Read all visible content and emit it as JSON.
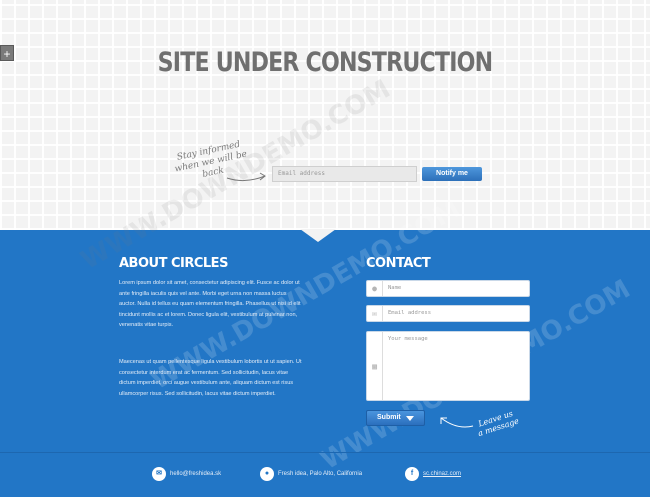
{
  "hero": {
    "title": "SITE UNDER CONSTRUCTION",
    "tagline_line1": "Stay informed",
    "tagline_line2": "when we will be back",
    "email_placeholder": "Email address",
    "notify_label": "Notify me"
  },
  "about": {
    "heading": "ABOUT CIRCLES",
    "paragraph1": "Lorem ipsum dolor sit amet, consectetur adipiscing elit. Fusce ac dolor ut ante fringilla iaculis quis vel ante. Morbi eget urna non massa luctus auctor. Nulla id tellus eu quam elementum fringilla. Phasellus ut nisi id elit tincidunt mollis ac et lorem. Donec ligula elit, vestibulum at pulvinar non, venenatis vitae turpis.",
    "paragraph2": "Maecenas ut quam pellentesque ligula vestibulum lobortis ut ut sapien. Ut consectetur interdum erat ac fermentum. Sed sollicitudin, lacus vitae dictum imperdiet, orci augue vestibulum ante, aliquam dictum est risus ullamcorper risus. Sed sollicitudin, lacus vitae dictum imperdiet."
  },
  "contact": {
    "heading": "CONTACT",
    "name_placeholder": "Name",
    "email_placeholder": "Email address",
    "message_placeholder": "Your message",
    "submit_label": "Submit",
    "leave_line1": "Leave us",
    "leave_line2": "a message"
  },
  "footer": {
    "email": "hello@freshidea.sk",
    "location": "Fresh idea, Palo Alto, California",
    "facebook": "sc.chinaz.com"
  },
  "watermark": "WWW.DOWNDEMO.COM",
  "icons": [
    "plus-icon",
    "user-icon",
    "envelope-icon",
    "chat-icon",
    "caret-down-icon",
    "email-icon",
    "location-pin-icon",
    "facebook-icon"
  ],
  "colors": {
    "brand_blue": "#2276c6",
    "title_gray": "#6f6f6f",
    "button_blue": "#2c6fb9"
  }
}
